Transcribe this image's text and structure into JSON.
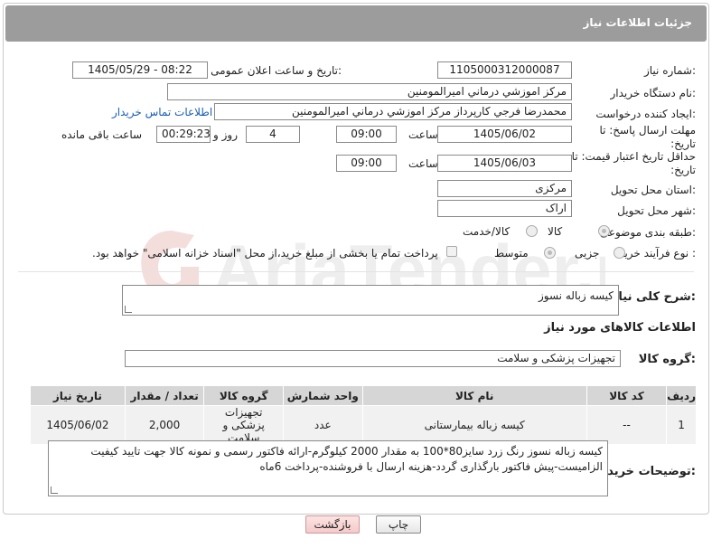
{
  "header": {
    "title": "جزئیات اطلاعات نیاز"
  },
  "fields": {
    "need_number_label": "شماره نیاز:",
    "need_number": "1105000312000087",
    "announce_label": "تاریخ و ساعت اعلان عمومی:",
    "announce_value": "1405/05/29 - 08:22",
    "buyer_org_label": "نام دستگاه خریدار:",
    "buyer_org": "مرکز اموزشي درماني اميرالمومنين",
    "creator_label": "ایجاد کننده درخواست:",
    "creator": "محمدرضا فرجي کارپرداز مرکز اموزشي درماني اميرالمومنين",
    "contact_link": "اطلاعات تماس خریدار",
    "deadline_label": "مهلت ارسال پاسخ: تا تاریخ:",
    "deadline_date": "1405/06/02",
    "time_label": "ساعت",
    "deadline_time": "09:00",
    "days_value": "4",
    "days_label": "روز و",
    "remaining_time": "00:29:23",
    "remaining_label": "ساعت باقی مانده",
    "price_validity_label": "حداقل تاریخ اعتبار قیمت: تا تاریخ:",
    "price_validity_date": "1405/06/03",
    "price_validity_time": "09:00",
    "province_label": "استان محل تحویل:",
    "province": "مرکزی",
    "city_label": "شهر محل تحویل:",
    "city": "اراک",
    "category_label": "طبقه بندی موضوعی:",
    "category_options": [
      "کالا",
      "کالا/خدمت"
    ],
    "process_label": "نوع فرآیند خرید :",
    "process_options": [
      "جزیی",
      "متوسط"
    ],
    "payment_note": "پرداخت تمام یا بخشی از مبلغ خرید،از محل \"اسناد خزانه اسلامی\" خواهد بود."
  },
  "description": {
    "label": "شرح کلی نیاز:",
    "value": "کیسه زباله نسوز"
  },
  "goods_section_title": "اطلاعات کالاهای مورد نیاز",
  "goods_group": {
    "label": "گروه کالا:",
    "value": "تجهیزات پزشکی و سلامت"
  },
  "table": {
    "headers": [
      "ردیف",
      "کد کالا",
      "نام کالا",
      "واحد شمارش",
      "گروه کالا",
      "تعداد / مقدار",
      "تاریخ نیاز"
    ],
    "rows": [
      [
        "1",
        "--",
        "کیسه زباله بیمارستانی",
        "عدد",
        "تجهیزات پزشکی و سلامت",
        "2,000",
        "1405/06/02"
      ]
    ]
  },
  "buyer_notes": {
    "label": "توضیحات خریدار:",
    "value": "کیسه زباله نسوز رنگ زرد سایز80*100 به مقدار 2000 کیلوگرم-ارائه فاکتور رسمی و نمونه کالا جهت تایید کیفیت الزامیست-پیش فاکتور بارگذاری گردد-هزینه ارسال با فروشنده-پرداخت 6ماه"
  },
  "buttons": {
    "print": "چاپ",
    "back": "بازگشت"
  },
  "watermark_text": "AriaTender.neT"
}
